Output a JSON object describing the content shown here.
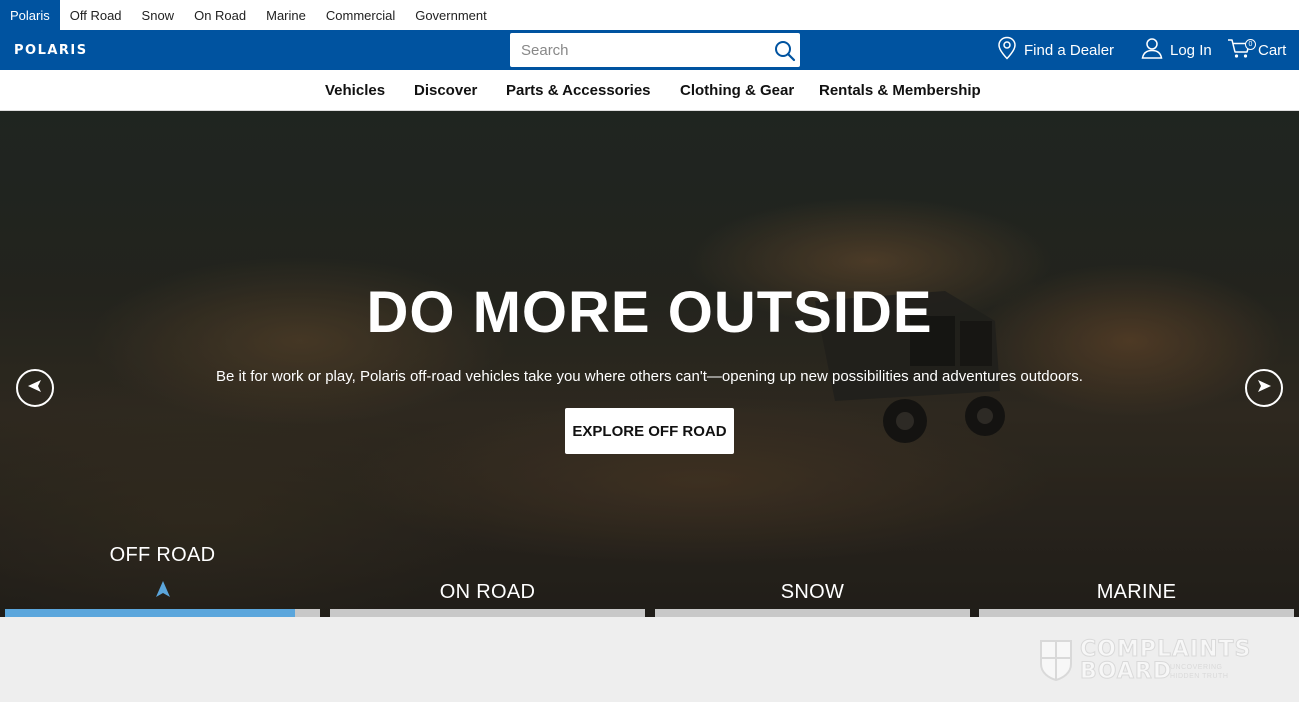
{
  "brand_bar": {
    "items": [
      {
        "label": "Polaris",
        "active": true
      },
      {
        "label": "Off Road"
      },
      {
        "label": "Snow"
      },
      {
        "label": "On Road"
      },
      {
        "label": "Marine"
      },
      {
        "label": "Commercial"
      },
      {
        "label": "Government"
      }
    ]
  },
  "header": {
    "logo_text": "POLARIS",
    "search": {
      "placeholder": "Search",
      "icon": "search-icon"
    },
    "find_dealer": {
      "label": "Find a Dealer",
      "icon": "location-pin-icon"
    },
    "login": {
      "label": "Log In",
      "icon": "user-icon"
    },
    "cart": {
      "label": "Cart",
      "count": "0",
      "icon": "cart-icon"
    }
  },
  "category_nav": {
    "items": [
      {
        "label": "Vehicles"
      },
      {
        "label": "Discover"
      },
      {
        "label": "Parts & Accessories"
      },
      {
        "label": "Clothing & Gear"
      },
      {
        "label": "Rentals & Membership"
      }
    ]
  },
  "hero": {
    "title": "DO MORE OUTSIDE",
    "subtitle": "Be it for work or play, Polaris off-road vehicles take you where others can't—opening up new possibilities and adventures outdoors.",
    "cta_label": "EXPLORE OFF ROAD",
    "prev_icon": "arrow-left-icon",
    "next_icon": "arrow-right-icon",
    "slides": [
      {
        "label": "OFF ROAD",
        "active": true,
        "progress": 0.92
      },
      {
        "label": "ON ROAD",
        "active": false,
        "progress": 0
      },
      {
        "label": "SNOW",
        "active": false,
        "progress": 0
      },
      {
        "label": "MARINE",
        "active": false,
        "progress": 0
      }
    ]
  },
  "watermark": {
    "line1": "COMPLAINTS",
    "line2": "BOARD",
    "tagline": "UNCOVERING HIDDEN TRUTH",
    "icon": "shield-logo-icon"
  },
  "colors": {
    "brand_blue": "#0053a0",
    "progress_fill": "#5ba6dc",
    "progress_track": "#c8c8c8"
  }
}
